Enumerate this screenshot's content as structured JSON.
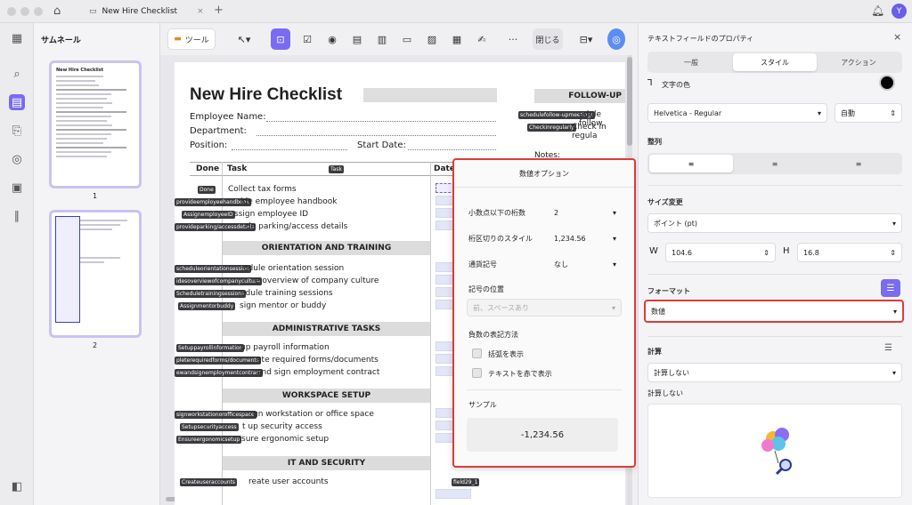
{
  "window": {
    "tab_title": "New Hire Checklist",
    "avatar": "Y",
    "plus": "+",
    "tab_close": "×"
  },
  "thumbnails": {
    "title": "サムネール",
    "pages": [
      "1",
      "2"
    ]
  },
  "toolbar": {
    "tools_label": "ツール",
    "close_label": "閉じる"
  },
  "document": {
    "title": "New Hire Checklist",
    "fields": [
      "Employee Name:",
      "Department:",
      "Position:",
      "Start Date:"
    ],
    "table_headers": {
      "done": "Done",
      "task": "Task",
      "date": "Date"
    },
    "tags": {
      "task": "Task",
      "done": "Done"
    },
    "sections": [
      "ORIENTATION AND TRAINING",
      "ADMINISTRATIVE TASKS",
      "WORKSPACE SETUP",
      "IT AND SECURITY"
    ],
    "rows": [
      {
        "tag": "",
        "text": "Collect tax forms"
      },
      {
        "tag": "provideemployeehandbook",
        "text": "ide employee handbook"
      },
      {
        "tag": "AssignemployeeID",
        "text": "ssign employee ID"
      },
      {
        "tag": "provideparking/accessdetails",
        "text": "de parking/access details"
      },
      {
        "tag": "scheduleorientationsession",
        "text": "edule orientation session"
      },
      {
        "tag": "idesoverviewofcompanyculture",
        "text": "e overview of company culture"
      },
      {
        "tag": "Scheduletrainingsessions",
        "text": "edule training sessions"
      },
      {
        "tag": "Assignmentorbuddy",
        "text": "sign mentor or buddy"
      },
      {
        "tag": "Setuppayrollinformation",
        "text": "up payroll information"
      },
      {
        "tag": "pleterequiredforms/documents",
        "text": "ete required forms/documents"
      },
      {
        "tag": "ewandsignemploymentcontract",
        "text": "and sign employment contract"
      },
      {
        "tag": "signworkstationorofficespace",
        "text": "gn workstation or office space"
      },
      {
        "tag": "Setupsecurityaccess",
        "text": "t up security access"
      },
      {
        "tag": "Ensureergonomicsetup",
        "text": "sure ergonomic setup"
      },
      {
        "tag": "Createuseraccounts",
        "text": "reate user accounts"
      }
    ],
    "field_label": "field29_1",
    "followup": {
      "title": "FOLLOW-UP",
      "tags": [
        "schedulefollow-upmeetings",
        "Checkinregularly"
      ],
      "lines": [
        "edule follow",
        "Check in regula"
      ],
      "notes": "Notes:"
    }
  },
  "popup": {
    "title": "数値オプション",
    "decimals_label": "小数点以下の桁数",
    "decimals_value": "2",
    "separator_label": "桁区切りのスタイル",
    "separator_value": "1,234.56",
    "currency_label": "通貨記号",
    "currency_value": "なし",
    "symbol_position_label": "記号の位置",
    "symbol_position_value": "前、スペースあり",
    "negative_label": "負数の表記方法",
    "paren_label": "括弧を表示",
    "red_label": "テキストを赤で表示",
    "sample_label": "サンプル",
    "sample_value": "-1,234.56"
  },
  "properties": {
    "title": "テキストフィールドのプロパティ",
    "tabs": [
      "一般",
      "スタイル",
      "アクション"
    ],
    "text_color_label": "文字の色",
    "font_value": "Helvetica - Regular",
    "font_size_value": "自動",
    "align_label": "整列",
    "resize_label": "サイズ変更",
    "unit_value": "ポイント (pt)",
    "w_label": "W",
    "w_value": "104.6",
    "h_label": "H",
    "h_value": "16.8",
    "format_label": "フォーマット",
    "format_value": "数値",
    "calc_label": "計算",
    "calc_value": "計算しない",
    "calc_text": "計算しない"
  }
}
